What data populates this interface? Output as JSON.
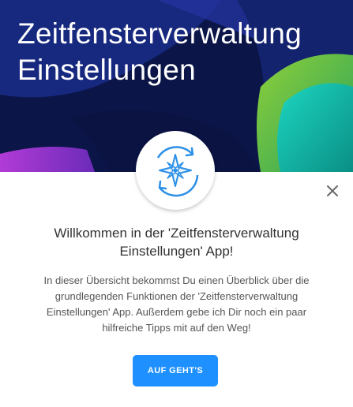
{
  "header": {
    "title_line1": "Zeitfensterverwaltung",
    "title_line2": "Einstellungen"
  },
  "dialog": {
    "heading_line1": "Willkommen in der 'Zeitfensterverwaltung",
    "heading_line2": "Einstellungen' App!",
    "body_line1": "In dieser Übersicht bekommst Du einen Überblick über die",
    "body_line2": "grundlegenden Funktionen der 'Zeitfensterverwaltung",
    "body_line3": "Einstellungen' App. Außerdem gebe ich Dir noch ein paar",
    "body_line4": "hilfreiche Tipps mit auf den Weg!",
    "cta_label": "AUF GEHT'S"
  },
  "icons": {
    "logo": "compass-sync-icon",
    "close": "close-icon"
  },
  "colors": {
    "hero_background": "#0b1547",
    "accent": "#1e90ff",
    "logo_blue": "#2b8fe6"
  }
}
